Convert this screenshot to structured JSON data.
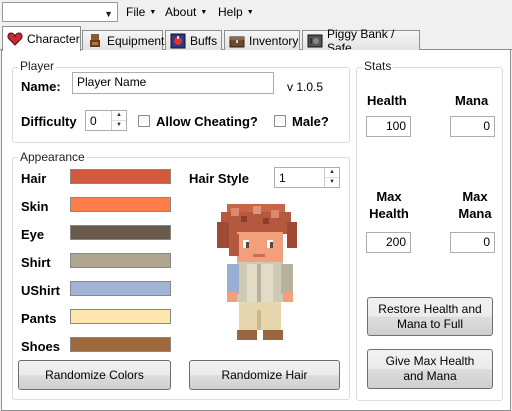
{
  "menubar": {
    "combo_value": "",
    "menus": [
      {
        "label": "File"
      },
      {
        "label": "About"
      },
      {
        "label": "Help"
      }
    ]
  },
  "tabs": [
    {
      "label": "Character",
      "icon": "heart-icon",
      "active": true
    },
    {
      "label": "Equipment",
      "icon": "armor-icon",
      "active": false
    },
    {
      "label": "Buffs",
      "icon": "potion-icon",
      "active": false
    },
    {
      "label": "Inventory",
      "icon": "chest-icon",
      "active": false
    },
    {
      "label": "Piggy Bank / Safe",
      "icon": "safe-icon",
      "active": false
    }
  ],
  "player": {
    "group_title": "Player",
    "name_label": "Name:",
    "name_value": "Player Name",
    "version": "v 1.0.5",
    "difficulty_label": "Difficulty",
    "difficulty_value": "0",
    "allow_cheating_label": "Allow Cheating?",
    "male_label": "Male?"
  },
  "appearance": {
    "group_title": "Appearance",
    "items": [
      {
        "label": "Hair",
        "color": "#d25a3c"
      },
      {
        "label": "Skin",
        "color": "#ff7d4b"
      },
      {
        "label": "Eye",
        "color": "#695a4b"
      },
      {
        "label": "Shirt",
        "color": "#afa58c"
      },
      {
        "label": "UShirt",
        "color": "#a0b4d7"
      },
      {
        "label": "Pants",
        "color": "#ffe6af"
      },
      {
        "label": "Shoes",
        "color": "#a0693c"
      }
    ],
    "hair_style_label": "Hair Style",
    "hair_style_value": "1",
    "randomize_colors_label": "Randomize Colors",
    "randomize_hair_label": "Randomize Hair"
  },
  "stats": {
    "group_title": "Stats",
    "health_label": "Health",
    "mana_label": "Mana",
    "health_value": "100",
    "mana_value": "0",
    "max_health_line1": "Max",
    "max_health_line2": "Health",
    "max_mana_line1": "Max",
    "max_mana_line2": "Mana",
    "max_health_value": "200",
    "max_mana_value": "0",
    "restore_line1": "Restore Health and",
    "restore_line2": "Mana to Full",
    "givemax_line1": "Give Max Health",
    "givemax_line2": "and Mana"
  }
}
